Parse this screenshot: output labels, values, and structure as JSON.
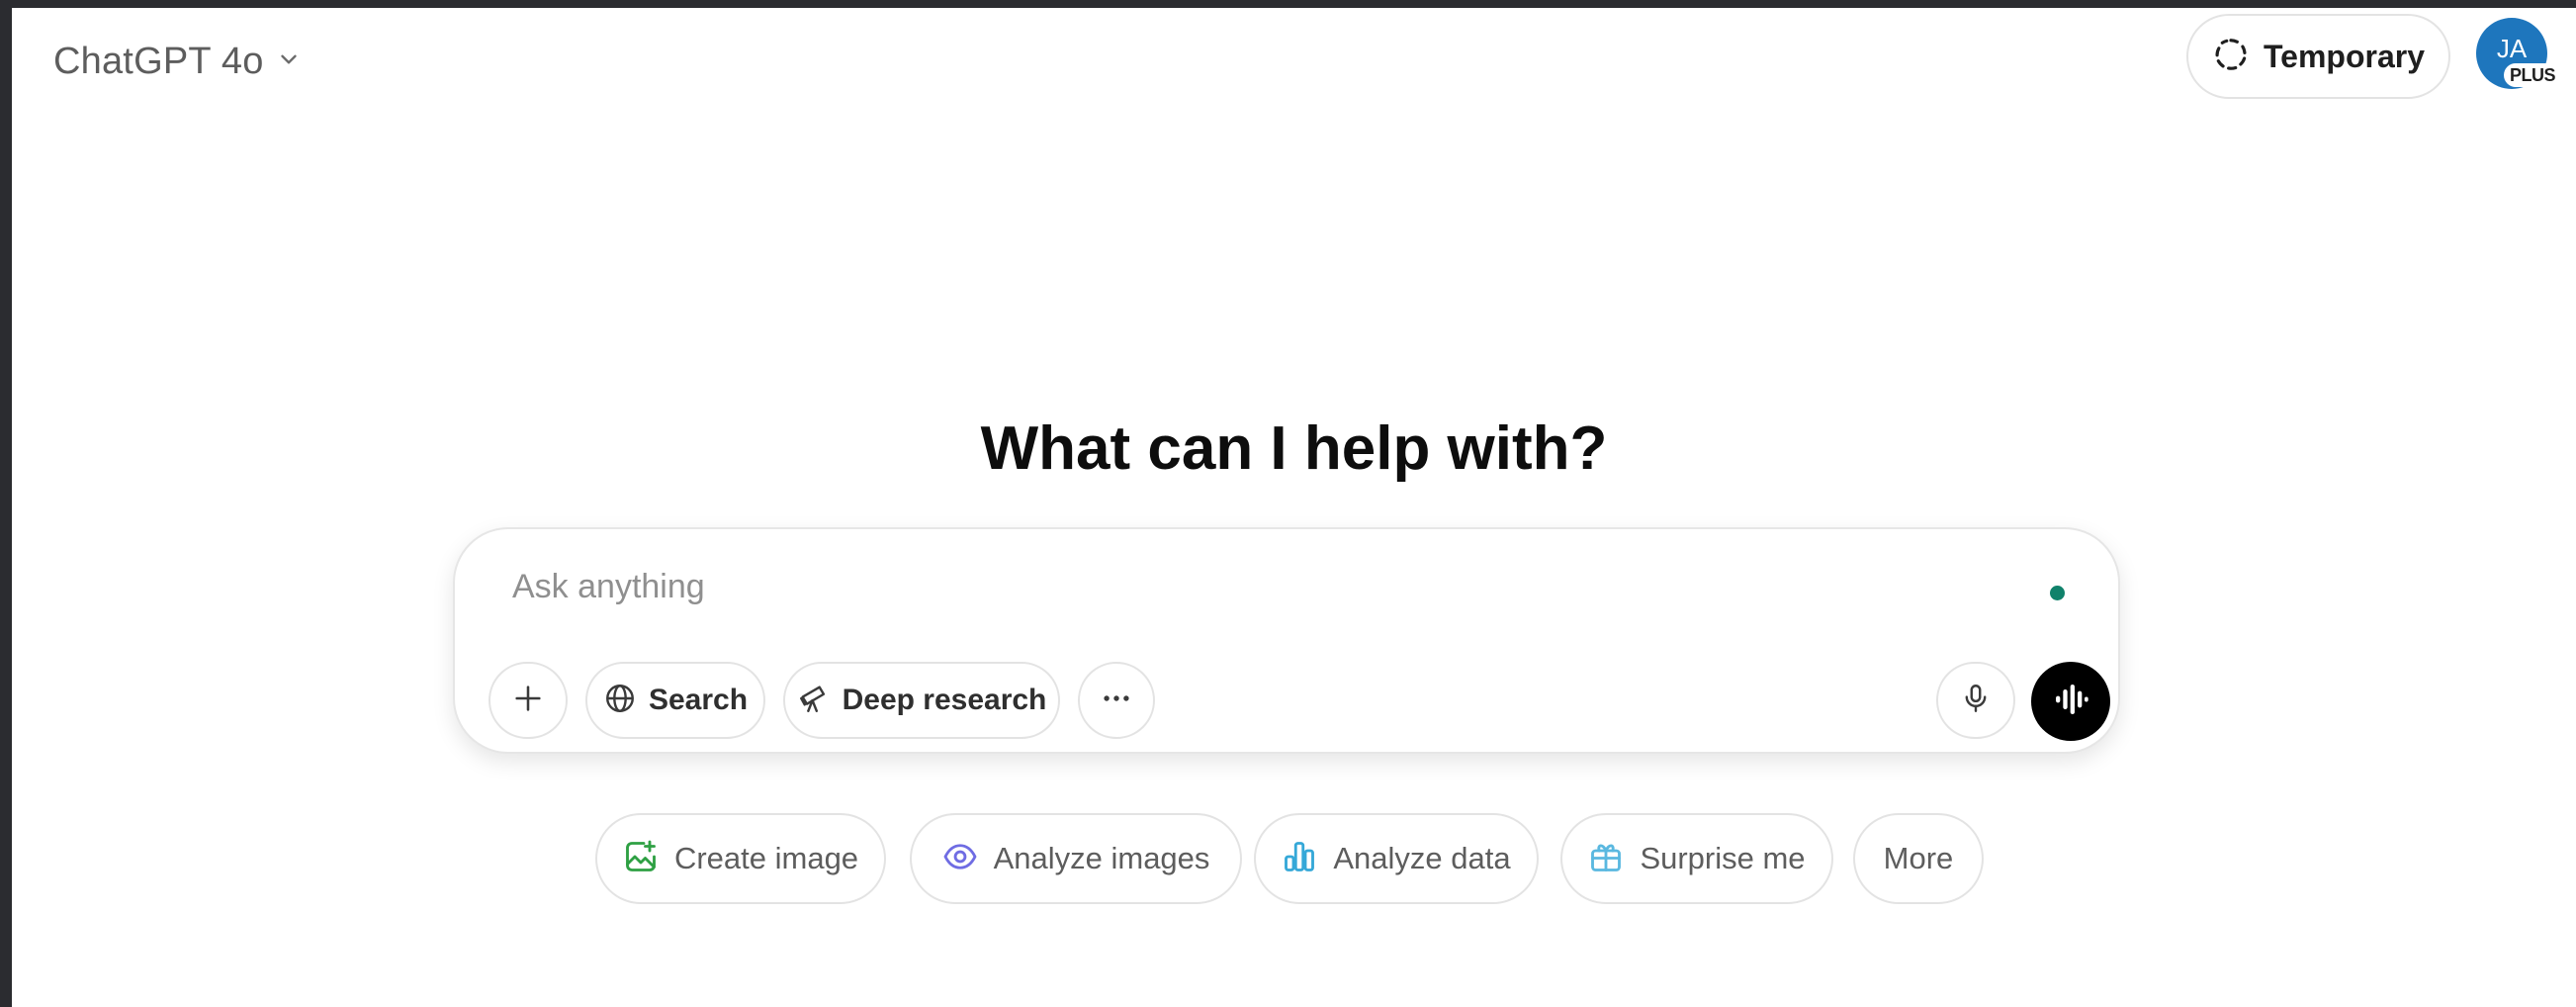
{
  "header": {
    "model_label": "ChatGPT 4o",
    "temporary_label": "Temporary",
    "avatar_initials": "JA",
    "plan_badge": "PLUS"
  },
  "main": {
    "heading": "What can I help with?"
  },
  "composer": {
    "placeholder": "Ask anything",
    "value": "",
    "tools": {
      "search_label": "Search",
      "deep_research_label": "Deep research"
    }
  },
  "suggestions": [
    {
      "label": "Create image",
      "icon": "image-icon"
    },
    {
      "label": "Analyze images",
      "icon": "eye-icon"
    },
    {
      "label": "Analyze data",
      "icon": "bar-chart-icon"
    },
    {
      "label": "Surprise me",
      "icon": "gift-icon"
    },
    {
      "label": "More",
      "icon": ""
    }
  ],
  "colors": {
    "avatar_bg": "#1e76bd",
    "status_dot": "#10826b",
    "create_image_icon": "#2ea043",
    "analyze_images_icon": "#6f6ce3",
    "analyze_data_icon": "#35a8d8",
    "surprise_me_icon": "#5ab8e0",
    "voice_button_bg": "#000000"
  }
}
